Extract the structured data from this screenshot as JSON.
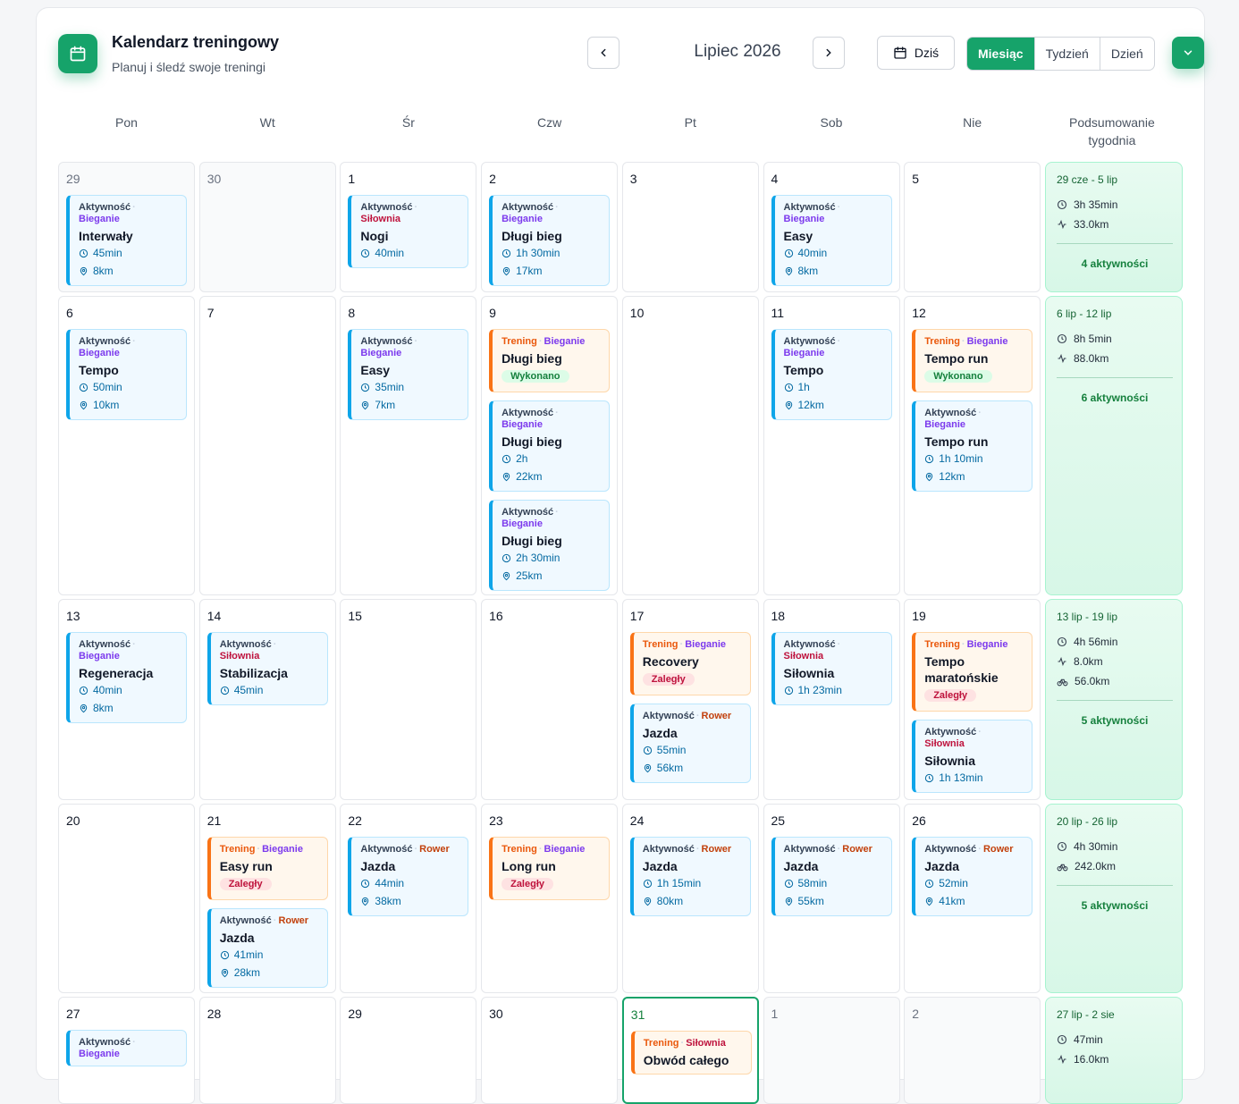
{
  "header": {
    "title": "Kalendarz treningowy",
    "subtitle": "Planuj i śledź swoje treningi",
    "month": "Lipiec 2026",
    "today": "Dziś",
    "views": [
      "Miesiąc",
      "Tydzień",
      "Dzień"
    ],
    "active_view": "Miesiąc"
  },
  "weekdays": [
    "Pon",
    "Wt",
    "Śr",
    "Czw",
    "Pt",
    "Sob",
    "Nie",
    "Podsumowanie tygodnia"
  ],
  "labels": {
    "activity": "Aktywność",
    "training": "Trening",
    "run": "Bieganie",
    "gym": "Siłownia",
    "bike": "Rower",
    "done": "Wykonano",
    "late": "Zaległy"
  },
  "weeks": [
    {
      "days": [
        {
          "num": "29",
          "other": true,
          "events": [
            {
              "kind": "activity",
              "sport": "run",
              "name": "Interwały",
              "dur": "45min",
              "dist": "8km"
            }
          ]
        },
        {
          "num": "30",
          "other": true,
          "events": []
        },
        {
          "num": "1",
          "events": [
            {
              "kind": "activity",
              "sport": "gym",
              "name": "Nogi",
              "dur": "40min"
            }
          ]
        },
        {
          "num": "2",
          "events": [
            {
              "kind": "activity",
              "sport": "run",
              "name": "Długi bieg",
              "dur": "1h 30min",
              "dist": "17km"
            }
          ]
        },
        {
          "num": "3",
          "events": []
        },
        {
          "num": "4",
          "events": [
            {
              "kind": "activity",
              "sport": "run",
              "name": "Easy",
              "dur": "40min",
              "dist": "8km"
            }
          ]
        },
        {
          "num": "5",
          "events": []
        }
      ],
      "summary": {
        "range": "29 cze - 5 lip",
        "time": "3h 35min",
        "run_km": "33.0km",
        "count": "4 aktywności"
      }
    },
    {
      "days": [
        {
          "num": "6",
          "events": [
            {
              "kind": "activity",
              "sport": "run",
              "name": "Tempo",
              "dur": "50min",
              "dist": "10km"
            }
          ]
        },
        {
          "num": "7",
          "events": []
        },
        {
          "num": "8",
          "events": [
            {
              "kind": "activity",
              "sport": "run",
              "name": "Easy",
              "dur": "35min",
              "dist": "7km"
            }
          ]
        },
        {
          "num": "9",
          "events": [
            {
              "kind": "training",
              "sport": "run",
              "name": "Długi bieg",
              "status": "done"
            },
            {
              "kind": "activity",
              "sport": "run",
              "name": "Długi bieg",
              "dur": "2h",
              "dist": "22km"
            },
            {
              "kind": "activity",
              "sport": "run",
              "name": "Długi bieg",
              "dur": "2h 30min",
              "dist": "25km"
            }
          ]
        },
        {
          "num": "10",
          "events": []
        },
        {
          "num": "11",
          "events": [
            {
              "kind": "activity",
              "sport": "run",
              "name": "Tempo",
              "dur": "1h",
              "dist": "12km"
            }
          ]
        },
        {
          "num": "12",
          "events": [
            {
              "kind": "training",
              "sport": "run",
              "name": "Tempo run",
              "status": "done"
            },
            {
              "kind": "activity",
              "sport": "run",
              "name": "Tempo run",
              "dur": "1h 10min",
              "dist": "12km"
            }
          ]
        }
      ],
      "summary": {
        "range": "6 lip - 12 lip",
        "time": "8h 5min",
        "run_km": "88.0km",
        "count": "6 aktywności"
      }
    },
    {
      "days": [
        {
          "num": "13",
          "events": [
            {
              "kind": "activity",
              "sport": "run",
              "name": "Regeneracja",
              "dur": "40min",
              "dist": "8km"
            }
          ]
        },
        {
          "num": "14",
          "events": [
            {
              "kind": "activity",
              "sport": "gym",
              "name": "Stabilizacja",
              "dur": "45min"
            }
          ]
        },
        {
          "num": "15",
          "events": []
        },
        {
          "num": "16",
          "events": []
        },
        {
          "num": "17",
          "events": [
            {
              "kind": "training",
              "sport": "run",
              "name": "Recovery",
              "status": "late"
            },
            {
              "kind": "activity",
              "sport": "bike",
              "name": "Jazda",
              "dur": "55min",
              "dist": "56km"
            }
          ]
        },
        {
          "num": "18",
          "events": [
            {
              "kind": "activity",
              "sport": "gym",
              "name": "Siłownia",
              "dur": "1h 23min"
            }
          ]
        },
        {
          "num": "19",
          "events": [
            {
              "kind": "training",
              "sport": "run",
              "name": "Tempo maratońskie",
              "status": "late"
            },
            {
              "kind": "activity",
              "sport": "gym",
              "name": "Siłownia",
              "dur": "1h 13min"
            }
          ]
        }
      ],
      "summary": {
        "range": "13 lip - 19 lip",
        "time": "4h 56min",
        "run_km": "8.0km",
        "bike_km": "56.0km",
        "count": "5 aktywności"
      }
    },
    {
      "days": [
        {
          "num": "20",
          "events": []
        },
        {
          "num": "21",
          "events": [
            {
              "kind": "training",
              "sport": "run",
              "name": "Easy run",
              "status": "late"
            },
            {
              "kind": "activity",
              "sport": "bike",
              "name": "Jazda",
              "dur": "41min",
              "dist": "28km"
            }
          ]
        },
        {
          "num": "22",
          "events": [
            {
              "kind": "activity",
              "sport": "bike",
              "name": "Jazda",
              "dur": "44min",
              "dist": "38km"
            }
          ]
        },
        {
          "num": "23",
          "events": [
            {
              "kind": "training",
              "sport": "run",
              "name": "Long run",
              "status": "late"
            }
          ]
        },
        {
          "num": "24",
          "events": [
            {
              "kind": "activity",
              "sport": "bike",
              "name": "Jazda",
              "dur": "1h 15min",
              "dist": "80km"
            }
          ]
        },
        {
          "num": "25",
          "events": [
            {
              "kind": "activity",
              "sport": "bike",
              "name": "Jazda",
              "dur": "58min",
              "dist": "55km"
            }
          ]
        },
        {
          "num": "26",
          "events": [
            {
              "kind": "activity",
              "sport": "bike",
              "name": "Jazda",
              "dur": "52min",
              "dist": "41km"
            }
          ]
        }
      ],
      "summary": {
        "range": "20 lip - 26 lip",
        "time": "4h 30min",
        "bike_km": "242.0km",
        "count": "5 aktywności"
      }
    },
    {
      "days": [
        {
          "num": "27",
          "events": [
            {
              "kind": "activity",
              "sport": "run",
              "name": ""
            }
          ]
        },
        {
          "num": "28",
          "events": []
        },
        {
          "num": "29",
          "events": []
        },
        {
          "num": "30",
          "events": []
        },
        {
          "num": "31",
          "today": true,
          "events": [
            {
              "kind": "training",
              "sport": "gym",
              "name": "Obwód całego"
            }
          ]
        },
        {
          "num": "1",
          "other": true,
          "events": []
        },
        {
          "num": "2",
          "other": true,
          "events": []
        }
      ],
      "summary": {
        "range": "27 lip - 2 sie",
        "time": "47min",
        "run_km": "16.0km"
      }
    }
  ]
}
